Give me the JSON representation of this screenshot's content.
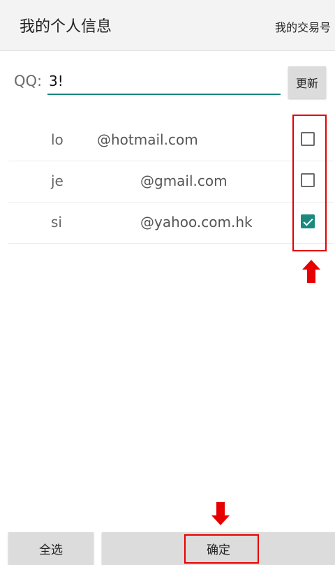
{
  "header": {
    "title": "我的个人信息",
    "action_label": "我的交易号"
  },
  "qq": {
    "label": "QQ:",
    "value": "3!",
    "update_label": "更新"
  },
  "emails": [
    {
      "prefix": "lo",
      "domain": "@hotmail.com",
      "checked": false
    },
    {
      "prefix": "je",
      "domain": "@gmail.com",
      "checked": false
    },
    {
      "prefix": "si",
      "domain": "@yahoo.com.hk",
      "checked": true
    }
  ],
  "footer": {
    "select_all_label": "全选",
    "confirm_label": "确定"
  },
  "colors": {
    "accent": "#17857a",
    "checkbox_checked": "#1a8a7e",
    "annotation": "#e60000",
    "button_bg": "#dcdcdc"
  }
}
